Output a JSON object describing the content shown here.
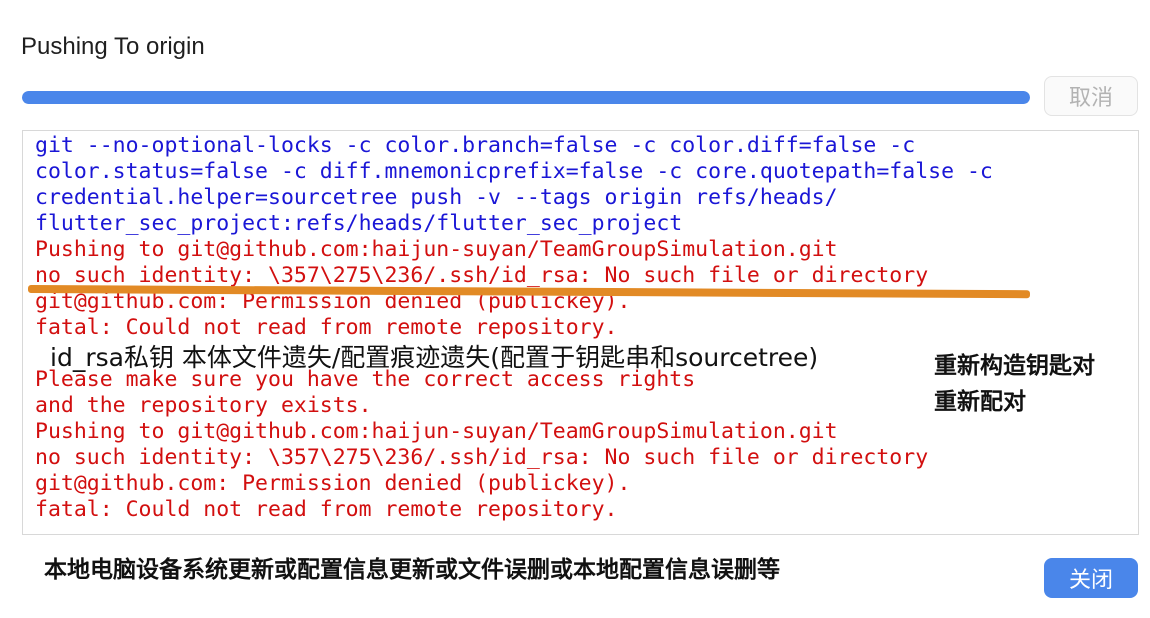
{
  "dialog": {
    "title": "Pushing To origin",
    "progress": 1.0,
    "cancel_label": "取消",
    "close_label": "关闭"
  },
  "log": {
    "lines": [
      {
        "text": "git --no-optional-locks -c color.branch=false -c color.diff=false -c",
        "kind": "cmd"
      },
      {
        "text": "color.status=false -c diff.mnemonicprefix=false -c core.quotepath=false -c",
        "kind": "cmd"
      },
      {
        "text": "credential.helper=sourcetree push -v --tags origin refs/heads/",
        "kind": "cmd"
      },
      {
        "text": "flutter_sec_project:refs/heads/flutter_sec_project",
        "kind": "cmd"
      },
      {
        "text": "Pushing to git@github.com:haijun-suyan/TeamGroupSimulation.git",
        "kind": "err"
      },
      {
        "text": "no such identity: \\357\\275\\236/.ssh/id_rsa: No such file or directory",
        "kind": "err"
      },
      {
        "text": "git@github.com: Permission denied (publickey).",
        "kind": "err"
      },
      {
        "text": "fatal: Could not read from remote repository.",
        "kind": "err"
      },
      {
        "text": "",
        "kind": "err"
      },
      {
        "text": "Please make sure you have the correct access rights",
        "kind": "err"
      },
      {
        "text": "and the repository exists.",
        "kind": "err"
      },
      {
        "text": "Pushing to git@github.com:haijun-suyan/TeamGroupSimulation.git",
        "kind": "err"
      },
      {
        "text": "no such identity: \\357\\275\\236/.ssh/id_rsa: No such file or directory",
        "kind": "err"
      },
      {
        "text": "git@github.com: Permission denied (publickey).",
        "kind": "err"
      },
      {
        "text": "fatal: Could not read from remote repository.",
        "kind": "err"
      }
    ]
  },
  "annotations": {
    "overlay": "id_rsa私钥 本体文件遗失/配置痕迹遗失(配置于钥匙串和sourcetree)",
    "right_line1": "重新构造钥匙对",
    "right_line2": "重新配对",
    "bottom": "本地电脑设备系统更新或配置信息更新或文件误删或本地配置信息误删等",
    "underline_color": "#e28a25"
  },
  "colors": {
    "accent": "#4a86ea",
    "command_text": "#1a16d6",
    "error_text": "#d20f0f"
  }
}
